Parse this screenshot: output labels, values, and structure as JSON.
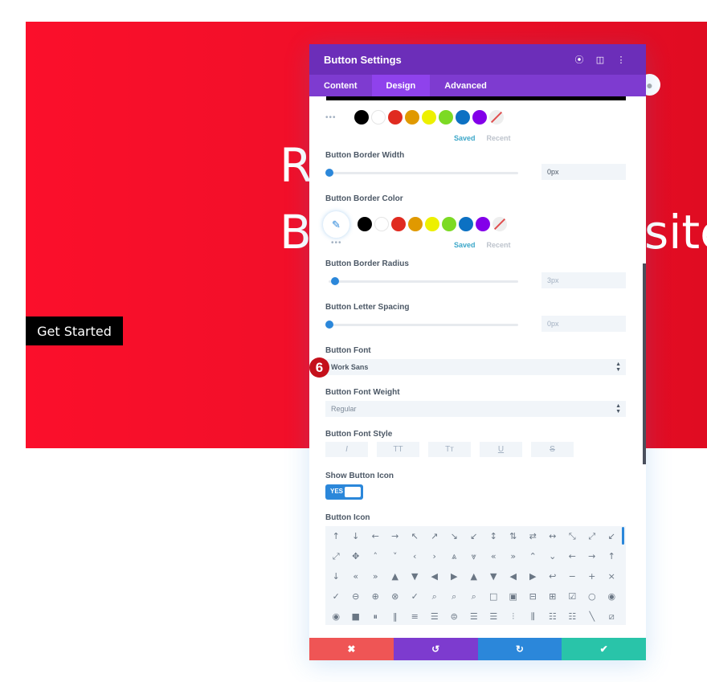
{
  "hero": {
    "title_line1": "R",
    "title_line2": "B",
    "title_tail": "site",
    "button_label": "Get Started",
    "background_color": "#f00f28"
  },
  "globe_icon": "●",
  "modal": {
    "title": "Button Settings",
    "header_icons": [
      "focus-icon",
      "sidebar-toggle-icon",
      "more-options-icon"
    ],
    "header_icon_glyphs": [
      "⦿",
      "◫",
      "⋮"
    ],
    "tabs": [
      {
        "label": "Content",
        "active": false
      },
      {
        "label": "Design",
        "active": true
      },
      {
        "label": "Advanced",
        "active": false
      }
    ],
    "palette_top": {
      "colors": [
        "#000000",
        "#ffffff",
        "#e02b20",
        "#e09900",
        "#edf000",
        "#7cda24",
        "#0c71c3",
        "#8300e9"
      ],
      "dots": "•••",
      "saved_label": "Saved",
      "recent_label": "Recent"
    },
    "border_width": {
      "label": "Button Border Width",
      "value": "0px",
      "slider_percent": 0
    },
    "border_color": {
      "label": "Button Border Color",
      "picker_icon": "✎",
      "colors": [
        "#000000",
        "#ffffff",
        "#e02b20",
        "#e09900",
        "#edf000",
        "#7cda24",
        "#0c71c3",
        "#8300e9"
      ],
      "dots": "•••",
      "saved_label": "Saved",
      "recent_label": "Recent"
    },
    "border_radius": {
      "label": "Button Border Radius",
      "value": "3px",
      "slider_percent": 3
    },
    "letter_spacing": {
      "label": "Button Letter Spacing",
      "value": "0px",
      "slider_percent": 0
    },
    "font": {
      "label": "Button Font",
      "value": "Work Sans",
      "step_badge": "6"
    },
    "font_weight": {
      "label": "Button Font Weight",
      "value": "Regular"
    },
    "font_style": {
      "label": "Button Font Style",
      "options": [
        {
          "name": "italic",
          "glyph": "I"
        },
        {
          "name": "uppercase",
          "glyph": "TT"
        },
        {
          "name": "small-caps",
          "glyph": "Tᴛ"
        },
        {
          "name": "underline",
          "glyph": "U"
        },
        {
          "name": "strikethrough",
          "glyph": "S"
        }
      ]
    },
    "show_icon": {
      "label": "Show Button Icon",
      "value": "YES",
      "enabled": true
    },
    "button_icon": {
      "label": "Button Icon",
      "icons": [
        "↑",
        "↓",
        "←",
        "→",
        "↖",
        "↗",
        "↘",
        "↙",
        "↕",
        "⇅",
        "⇄",
        "↔",
        "⤡",
        "⤢",
        "↙",
        "⤢",
        "✥",
        "˄",
        "˅",
        "‹",
        "›",
        "⩓",
        "⩔",
        "«",
        "»",
        "⌃",
        "⌄",
        "←",
        "→",
        "↑",
        "↓",
        "«",
        "»",
        "▲",
        "▼",
        "◀",
        "▶",
        "▲",
        "▼",
        "◀",
        "▶",
        "↩",
        "−",
        "+",
        "×",
        "✓",
        "⊖",
        "⊕",
        "⊗",
        "✓",
        "⌕",
        "⌕",
        "⌕",
        "□",
        "▣",
        "⊟",
        "⊞",
        "☑",
        "○",
        "◉",
        "◉",
        "■",
        "⏸",
        "‖",
        "≡",
        "☰",
        "⊜",
        "☰",
        "☰",
        "⫶",
        "⫼",
        "☷",
        "☷",
        "╲",
        "⧄"
      ]
    },
    "footer": {
      "cancel_icon": "✖",
      "undo_icon": "↺",
      "redo_icon": "↻",
      "save_icon": "✔"
    }
  }
}
